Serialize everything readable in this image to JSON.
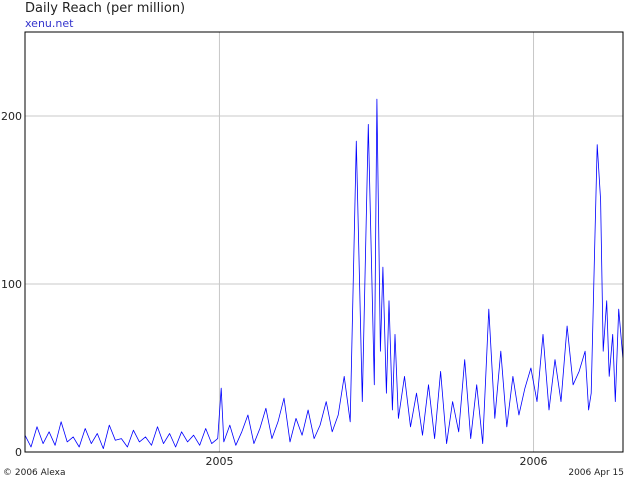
{
  "chart_data": {
    "type": "line",
    "title": "Daily Reach (per million)",
    "subtitle": "xenu.net",
    "ylim": [
      0,
      250
    ],
    "y_ticks": [
      0,
      100,
      200
    ],
    "xlim": [
      "2004-05-20",
      "2006-04-15"
    ],
    "x_ticks": [
      {
        "x": "2005-01-01",
        "label": "2005"
      },
      {
        "x": "2006-01-01",
        "label": "2006"
      }
    ],
    "grid": true,
    "series_color": "#0000ff",
    "footer_left": "© 2006 Alexa",
    "footer_right": "2006 Apr 15",
    "series": [
      {
        "x": [
          "2004-05-20",
          "2004-05-27",
          "2004-06-03",
          "2004-06-10",
          "2004-06-17",
          "2004-06-24",
          "2004-07-01",
          "2004-07-08",
          "2004-07-15",
          "2004-07-22",
          "2004-07-29",
          "2004-08-05",
          "2004-08-12",
          "2004-08-19",
          "2004-08-26",
          "2004-09-02",
          "2004-09-09",
          "2004-09-16",
          "2004-09-23",
          "2004-09-30",
          "2004-10-07",
          "2004-10-14",
          "2004-10-21",
          "2004-10-28",
          "2004-11-04",
          "2004-11-11",
          "2004-11-18",
          "2004-11-25",
          "2004-12-02",
          "2004-12-09",
          "2004-12-16",
          "2004-12-23",
          "2004-12-30",
          "2005-01-03",
          "2005-01-06",
          "2005-01-13",
          "2005-01-20",
          "2005-01-27",
          "2005-02-03",
          "2005-02-10",
          "2005-02-17",
          "2005-02-24",
          "2005-03-03",
          "2005-03-10",
          "2005-03-17",
          "2005-03-24",
          "2005-03-31",
          "2005-04-07",
          "2005-04-14",
          "2005-04-21",
          "2005-04-28",
          "2005-05-05",
          "2005-05-12",
          "2005-05-19",
          "2005-05-26",
          "2005-06-02",
          "2005-06-09",
          "2005-06-16",
          "2005-06-23",
          "2005-06-30",
          "2005-07-03",
          "2005-07-07",
          "2005-07-10",
          "2005-07-14",
          "2005-07-17",
          "2005-07-21",
          "2005-07-24",
          "2005-07-28",
          "2005-08-04",
          "2005-08-11",
          "2005-08-18",
          "2005-08-25",
          "2005-09-01",
          "2005-09-08",
          "2005-09-15",
          "2005-09-22",
          "2005-09-29",
          "2005-10-06",
          "2005-10-13",
          "2005-10-20",
          "2005-10-27",
          "2005-11-03",
          "2005-11-10",
          "2005-11-17",
          "2005-11-24",
          "2005-12-01",
          "2005-12-08",
          "2005-12-15",
          "2005-12-22",
          "2005-12-29",
          "2006-01-05",
          "2006-01-12",
          "2006-01-19",
          "2006-01-26",
          "2006-02-02",
          "2006-02-09",
          "2006-02-16",
          "2006-02-23",
          "2006-03-02",
          "2006-03-06",
          "2006-03-09",
          "2006-03-13",
          "2006-03-16",
          "2006-03-20",
          "2006-03-23",
          "2006-03-27",
          "2006-03-30",
          "2006-04-03",
          "2006-04-06",
          "2006-04-10",
          "2006-04-15"
        ],
        "values": [
          10,
          3,
          15,
          5,
          12,
          4,
          18,
          6,
          9,
          3,
          14,
          5,
          11,
          2,
          16,
          7,
          8,
          3,
          13,
          6,
          9,
          4,
          15,
          5,
          11,
          3,
          12,
          6,
          10,
          4,
          14,
          5,
          8,
          38,
          6,
          16,
          4,
          12,
          22,
          5,
          14,
          26,
          8,
          18,
          32,
          6,
          20,
          10,
          25,
          8,
          16,
          30,
          12,
          22,
          45,
          18,
          185,
          30,
          195,
          40,
          210,
          60,
          110,
          35,
          90,
          25,
          70,
          20,
          45,
          15,
          35,
          10,
          40,
          8,
          48,
          5,
          30,
          12,
          55,
          8,
          40,
          5,
          85,
          20,
          60,
          15,
          45,
          22,
          38,
          50,
          30,
          70,
          25,
          55,
          30,
          75,
          40,
          48,
          60,
          25,
          35,
          120,
          183,
          150,
          60,
          90,
          45,
          70,
          30,
          85,
          55
        ]
      }
    ]
  }
}
